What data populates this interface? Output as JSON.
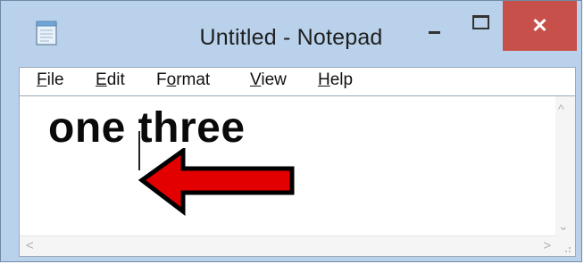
{
  "window": {
    "title": "Untitled - Notepad",
    "close_glyph": "✕",
    "controls": [
      "minimize-icon",
      "maximize-icon",
      "close-icon"
    ]
  },
  "menu": [
    {
      "u": "F",
      "rest": "ile"
    },
    {
      "u": "E",
      "rest": "dit"
    },
    {
      "pre": "F",
      "u": "o",
      "rest": "rmat"
    },
    {
      "u": "V",
      "rest": "iew"
    },
    {
      "u": "H",
      "rest": "elp"
    }
  ],
  "editor": {
    "text": "one three"
  },
  "scroll": {
    "up": "^",
    "down": "⌄",
    "left": "<",
    "right": ">",
    "grip": ".::"
  },
  "annotation": {
    "arrow_color": "#e30000",
    "arrow_direction": "left"
  }
}
